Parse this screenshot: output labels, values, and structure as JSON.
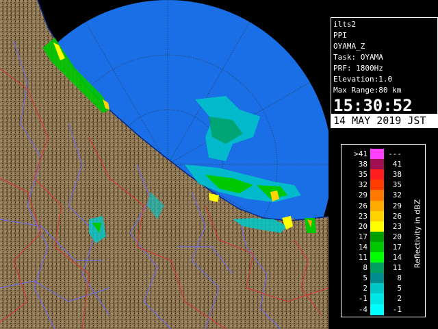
{
  "info": {
    "lines": [
      "ilts2",
      "PPI",
      "OYAMA_Z",
      "Task: OYAMA",
      "PRF: 1800Hz",
      "Elevation:1.0",
      "Max Range:80 km"
    ],
    "time": "15:30:52",
    "date": "14 MAY 2019 JST"
  },
  "legend": {
    "unit_label": "Reflectivity in dBZ",
    "rows": [
      {
        "low": ">41",
        "high": "---",
        "color": "#ff40ff"
      },
      {
        "low": "38",
        "high": "41",
        "color": "#a01050"
      },
      {
        "low": "35",
        "high": "38",
        "color": "#ff1e1e"
      },
      {
        "low": "32",
        "high": "35",
        "color": "#ff3c00"
      },
      {
        "low": "29",
        "high": "32",
        "color": "#ff7800"
      },
      {
        "low": "26",
        "high": "29",
        "color": "#ffaa00"
      },
      {
        "low": "23",
        "high": "26",
        "color": "#ffd200"
      },
      {
        "low": "20",
        "high": "23",
        "color": "#ffff00"
      },
      {
        "low": "17",
        "high": "20",
        "color": "#00a000"
      },
      {
        "low": "14",
        "high": "17",
        "color": "#00c800"
      },
      {
        "low": "11",
        "high": "14",
        "color": "#00ff00"
      },
      {
        "low": "8",
        "high": "11",
        "color": "#00a060"
      },
      {
        "low": "5",
        "high": "8",
        "color": "#008c8c"
      },
      {
        "low": "2",
        "high": "5",
        "color": "#00c8c8"
      },
      {
        "low": "-1",
        "high": "2",
        "color": "#00e6e6"
      },
      {
        "low": "-4",
        "high": "-1",
        "color": "#00ffff"
      }
    ]
  },
  "colors": {
    "sea": "#1a6ee6",
    "land": "#8a7350",
    "river": "#6b6bff",
    "border": "#e03030"
  }
}
